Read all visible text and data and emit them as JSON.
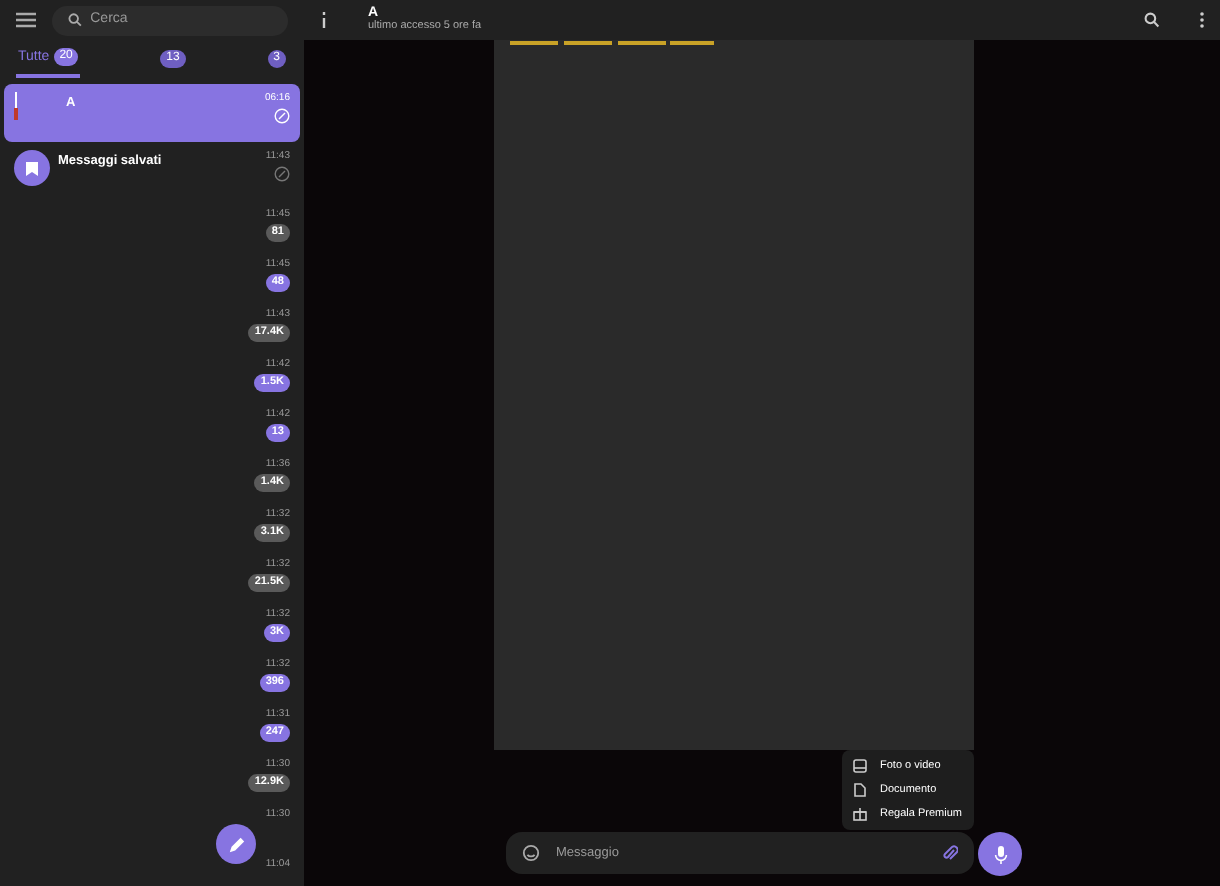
{
  "search": {
    "placeholder": "Cerca"
  },
  "tabs": [
    {
      "label": "Tutte",
      "count": "20",
      "selected": true
    },
    {
      "count": "13",
      "selected": false
    },
    {
      "count": "3",
      "selected": false
    }
  ],
  "chats": [
    {
      "kind": "contact",
      "title": "A",
      "time": "06:16",
      "selected": true,
      "pinned": true
    },
    {
      "kind": "saved",
      "title": "Messaggi salvati",
      "time": "11:43",
      "selected": false,
      "pinned": true
    },
    {
      "kind": "blank",
      "time": "11:45",
      "badge": "81",
      "muted": true,
      "selected": false
    },
    {
      "kind": "blank",
      "time": "11:45",
      "badge": "48",
      "muted": false,
      "selected": false
    },
    {
      "kind": "blank",
      "time": "11:43",
      "badge": "17.4K",
      "muted": true,
      "selected": false
    },
    {
      "kind": "blank",
      "time": "11:42",
      "badge": "1.5K",
      "muted": false,
      "selected": false
    },
    {
      "kind": "blank",
      "time": "11:42",
      "badge": "13",
      "muted": false,
      "selected": false
    },
    {
      "kind": "blank",
      "time": "11:36",
      "badge": "1.4K",
      "muted": true,
      "selected": false
    },
    {
      "kind": "blank",
      "time": "11:32",
      "badge": "3.1K",
      "muted": true,
      "selected": false
    },
    {
      "kind": "blank",
      "time": "11:32",
      "badge": "21.5K",
      "muted": true,
      "selected": false
    },
    {
      "kind": "blank",
      "time": "11:32",
      "badge": "3K",
      "muted": false,
      "selected": false
    },
    {
      "kind": "blank",
      "time": "11:32",
      "badge": "396",
      "muted": false,
      "selected": false
    },
    {
      "kind": "blank",
      "time": "11:31",
      "badge": "247",
      "muted": false,
      "selected": false
    },
    {
      "kind": "blank",
      "time": "11:30",
      "badge": "12.9K",
      "muted": true,
      "selected": false
    },
    {
      "kind": "blank",
      "time": "11:30",
      "selected": false
    },
    {
      "kind": "blank",
      "time": "11:04",
      "selected": false
    }
  ],
  "header": {
    "title": "A",
    "subtitle": "ultimo accesso 5 ore fa"
  },
  "attach_menu": [
    {
      "kind": "media",
      "label": "Foto o video"
    },
    {
      "kind": "document",
      "label": "Documento"
    },
    {
      "kind": "gift",
      "label": "Regala Premium"
    }
  ],
  "composer": {
    "placeholder": "Messaggio"
  }
}
